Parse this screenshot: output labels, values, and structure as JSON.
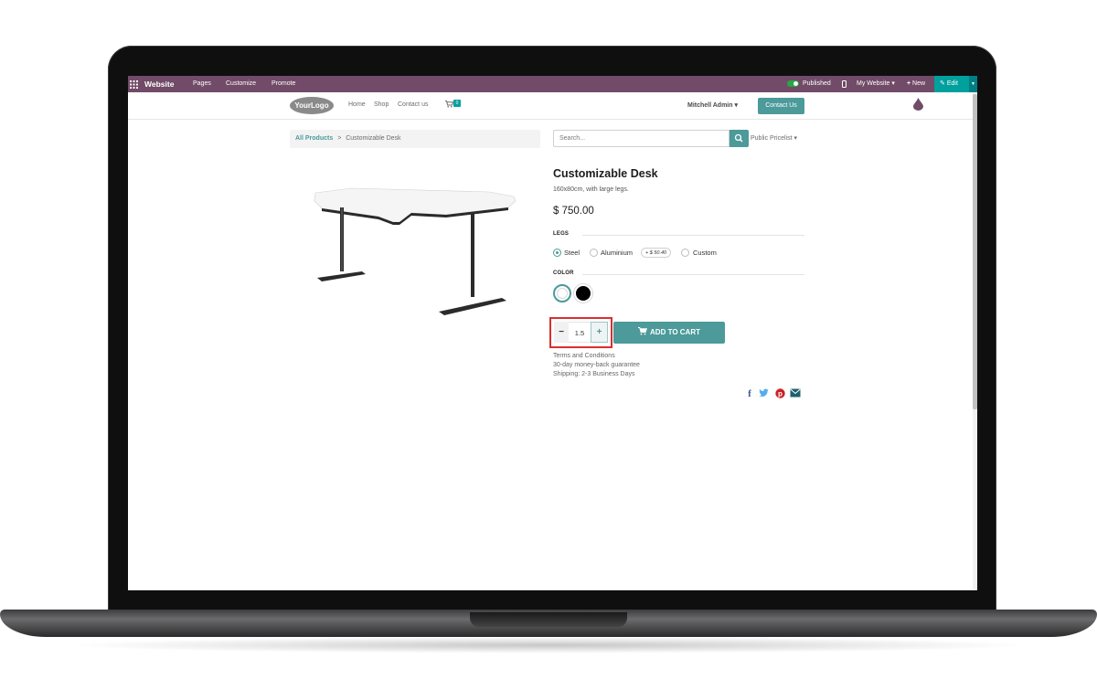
{
  "topbar": {
    "brand": "Website",
    "menus": [
      "Pages",
      "Customize",
      "Promote"
    ],
    "published_label": "Published",
    "site_label": "My Website",
    "new_label": "New",
    "edit_label": "Edit",
    "colors": {
      "bar": "#714b67",
      "edit": "#00a09d",
      "toggle_on": "#28a745"
    }
  },
  "header": {
    "logo_text": "YourLogo",
    "nav": [
      "Home",
      "Shop",
      "Contact us"
    ],
    "cart_count": "0",
    "user_label": "Mitchell Admin",
    "contact_button": "Contact Us"
  },
  "breadcrumb": {
    "root": "All Products",
    "separator": ">",
    "current": "Customizable Desk"
  },
  "search": {
    "placeholder": "Search...",
    "pricelist": "Public Pricelist"
  },
  "product": {
    "name": "Customizable Desk",
    "description": "160x80cm, with large legs.",
    "price": "$ 750.00",
    "attributes": {
      "legs": {
        "label": "LEGS",
        "options": [
          "Steel",
          "Aluminium",
          "Custom"
        ],
        "selected": "Steel",
        "extra_price": "+ $ 50.40"
      },
      "color": {
        "label": "COLOR",
        "options": [
          {
            "name": "White",
            "hex": "#ffffff"
          },
          {
            "name": "Black",
            "hex": "#000000"
          }
        ],
        "selected": "White"
      }
    },
    "quantity": "1.5",
    "minus": "−",
    "plus": "+",
    "add_to_cart": "ADD TO CART",
    "terms": [
      "Terms and Conditions",
      "30-day money-back guarantee",
      "Shipping: 2-3 Business Days"
    ]
  },
  "share_icons": [
    "facebook-icon",
    "twitter-icon",
    "pinterest-icon",
    "email-icon"
  ],
  "accent_color": "#4c9a9a"
}
